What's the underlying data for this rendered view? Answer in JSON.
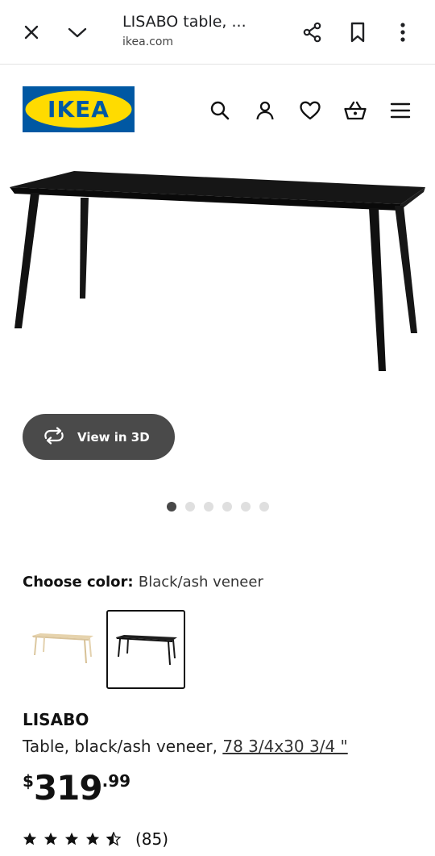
{
  "browser": {
    "title": "LISABO table, ...",
    "domain": "ikea.com"
  },
  "header": {
    "logo_text": "IKEA",
    "logo_colors": {
      "blue": "#0058A3",
      "yellow": "#FFDB00"
    }
  },
  "gallery": {
    "view_3d_label": "View in 3D",
    "dot_count": 6,
    "active_dot": 0
  },
  "color_chooser": {
    "label": "Choose color:",
    "selected_value": "Black/ash veneer",
    "options": [
      {
        "name": "white-stained-oak",
        "selected": false
      },
      {
        "name": "black-ash",
        "selected": true
      }
    ]
  },
  "product": {
    "name": "LISABO",
    "description": "Table, black/ash veneer, ",
    "size": "78 3/4x30 3/4 \"",
    "price_currency": "$",
    "price_integer": "319",
    "price_decimal": ".99",
    "rating_stars": 4.5,
    "rating_count": "(85)"
  }
}
